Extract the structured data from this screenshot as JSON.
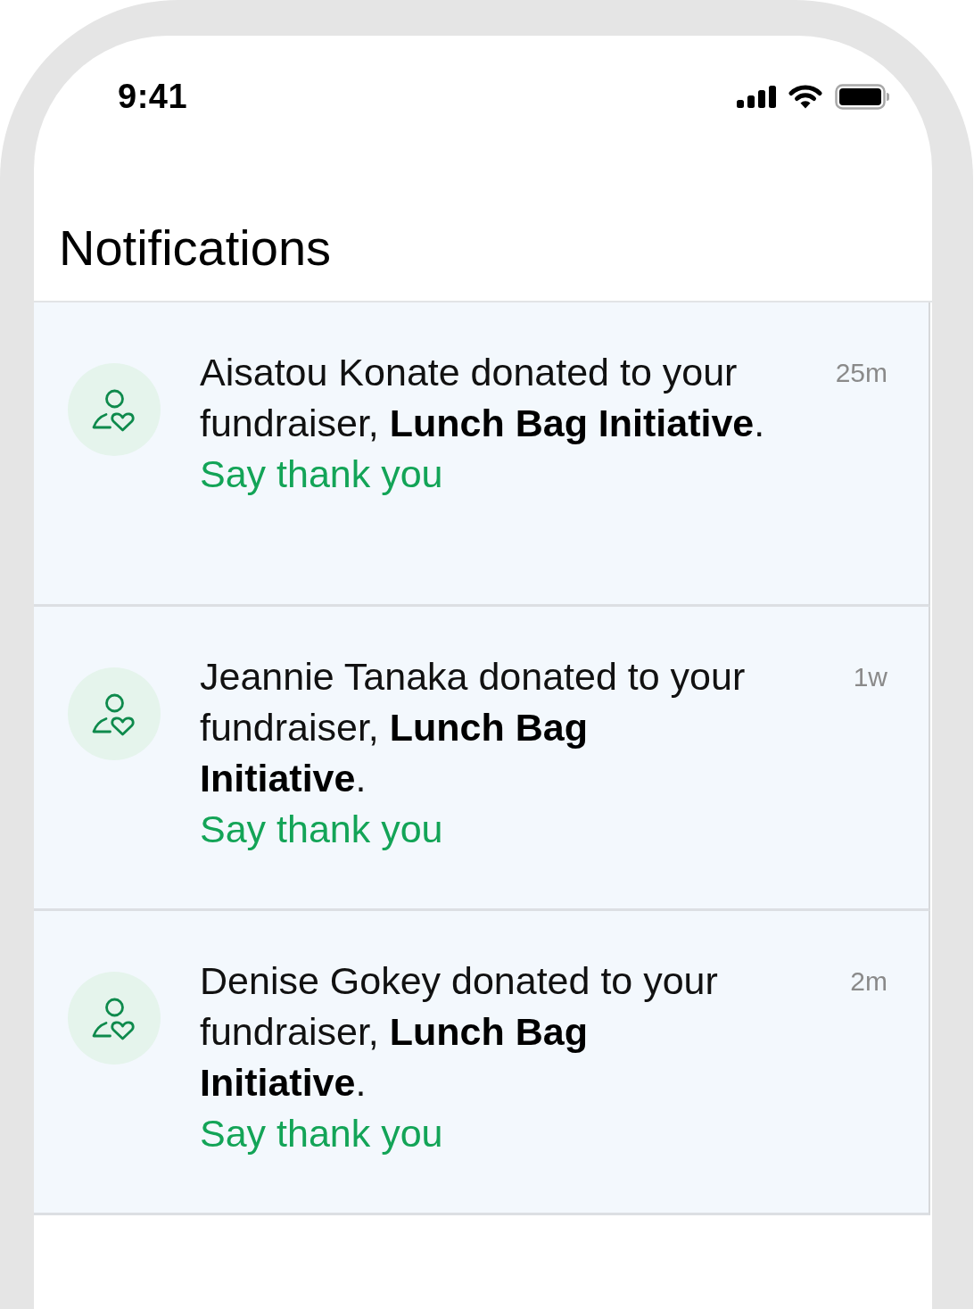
{
  "status_bar": {
    "time": "9:41"
  },
  "header": {
    "title": "Notifications"
  },
  "notifications": [
    {
      "message": "Aisatou Konate donated to your\nfundraiser, **Lunch Bag Initiative**.",
      "time": "25m",
      "action": "Say thank you"
    },
    {
      "message": "Jeannie Tanaka donated to your\nfundraiser, **Lunch Bag\nInitiative**.",
      "time": "1w",
      "action": "Say thank you"
    },
    {
      "message": "Denise Gokey donated to your\nfundraiser, **Lunch Bag\nInitiative**.",
      "time": "2m",
      "action": "Say thank you"
    }
  ]
}
